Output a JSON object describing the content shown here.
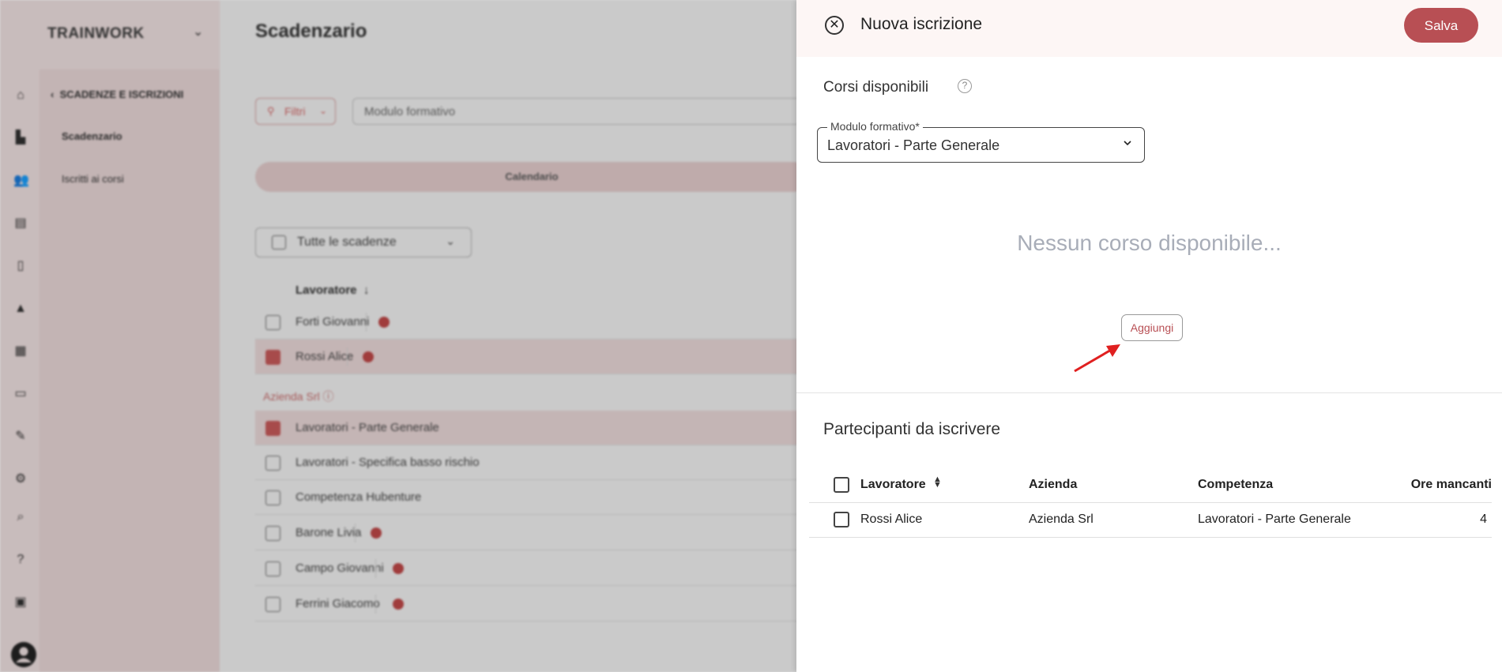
{
  "app": {
    "brand": "TRAINWORK",
    "page_title": "Scadenzario"
  },
  "sidebar": {
    "section_title": "SCADENZE E ISCRIZIONI",
    "items": [
      "Scadenzario",
      "Iscritti ai corsi"
    ]
  },
  "background": {
    "filter_label": "Filtri",
    "search_placeholder": "Modulo formativo",
    "calendar_label": "Calendario",
    "deadline_select": "Tutte le scadenze",
    "column_worker": "Lavoratore",
    "company_group": "Azienda Srl",
    "rows": [
      {
        "label": "Forti Giovanni",
        "selected": false,
        "alert": true
      },
      {
        "label": "Rossi Alice",
        "selected": true,
        "alert": true
      },
      {
        "label": "Lavoratori - Parte Generale",
        "selected": true,
        "alert": false
      },
      {
        "label": "Lavoratori - Specifica basso rischio",
        "selected": false,
        "alert": false
      },
      {
        "label": "Competenza Hubenture",
        "selected": false,
        "alert": false
      },
      {
        "label": "Barone Livia",
        "selected": false,
        "alert": true
      },
      {
        "label": "Campo Giovanni",
        "selected": false,
        "alert": true
      },
      {
        "label": "Ferrini Giacomo",
        "selected": false,
        "alert": true
      }
    ]
  },
  "drawer": {
    "title": "Nuova iscrizione",
    "save_label": "Salva",
    "available_courses": {
      "title": "Corsi disponibili",
      "field_label": "Modulo formativo*",
      "field_value": "Lavoratori - Parte Generale",
      "empty_message": "Nessun corso disponibile...",
      "add_label": "Aggiungi"
    },
    "participants": {
      "title": "Partecipanti da iscrivere",
      "columns": [
        "Lavoratore",
        "Azienda",
        "Competenza",
        "Ore mancanti"
      ],
      "rows": [
        {
          "worker": "Rossi Alice",
          "company": "Azienda Srl",
          "competence": "Lavoratori - Parte Generale",
          "hours": "4"
        }
      ]
    }
  },
  "colors": {
    "accent": "#b84f54",
    "header_bg": "#fdf6f5",
    "empty_text": "#a8adb8"
  },
  "icons": [
    "home-icon",
    "company-icon",
    "users-icon",
    "courses-icon",
    "document-icon",
    "graduation-icon",
    "calendar-icon",
    "folder-icon",
    "wrench-icon",
    "gear-icon",
    "search-icon",
    "help-icon",
    "inbox-icon",
    "account-icon"
  ]
}
